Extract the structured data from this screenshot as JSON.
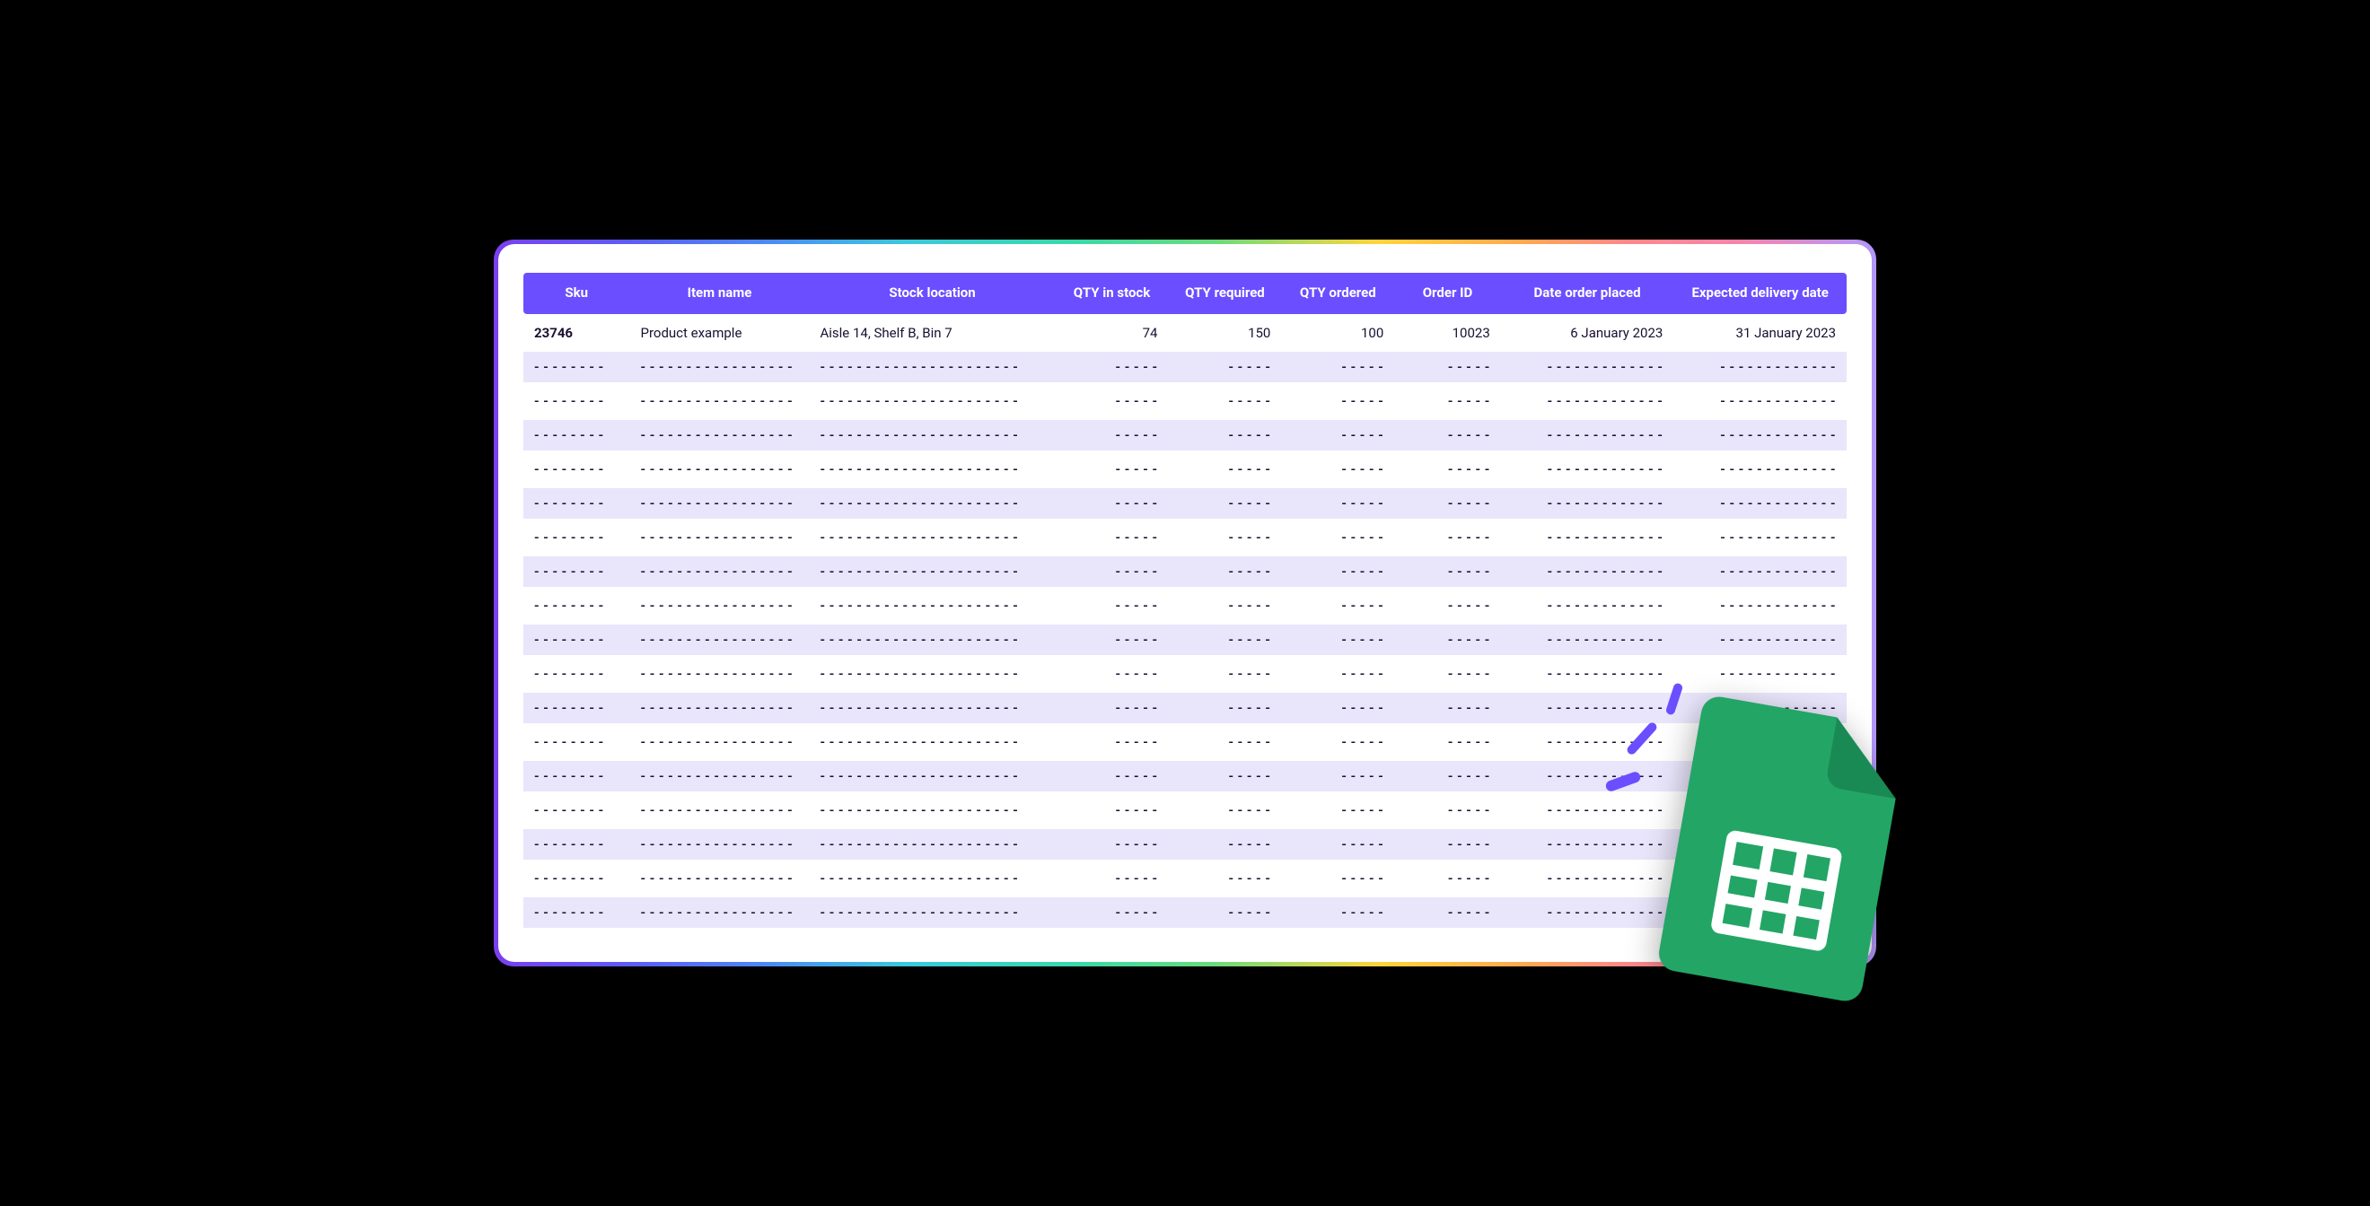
{
  "colors": {
    "header_bg": "#6b4eff",
    "header_text": "#ffffff",
    "placeholder_text": "#a79ef0",
    "row_alt_bg": "#e9e5fb",
    "sheets_green": "#23a566",
    "sheets_dark": "#1e8e5a"
  },
  "table": {
    "headers": {
      "sku": "Sku",
      "item_name": "Item name",
      "stock_location": "Stock location",
      "qty_in_stock": "QTY in stock",
      "qty_required": "QTY required",
      "qty_ordered": "QTY ordered",
      "order_id": "Order ID",
      "date_order_placed": "Date order placed",
      "expected_delivery_date": "Expected delivery date"
    },
    "rows": [
      {
        "sku": "23746",
        "item_name": "Product example",
        "stock_location": "Aisle 14, Shelf B, Bin 7",
        "qty_in_stock": "74",
        "qty_required": "150",
        "qty_ordered": "100",
        "order_id": "10023",
        "date_order_placed": "6 January 2023",
        "expected_delivery_date": "31 January 2023"
      }
    ],
    "placeholder_row_count": 17,
    "placeholder_dashes": {
      "short": "- - - - -",
      "medium": "- - - - - - - -",
      "long": "- - - - - - - - - - - - - - - - -",
      "xlong": "- - - - - - - - - - - - - - - - - - - - - -",
      "date": "- - - - - - - - - - - - -"
    }
  },
  "overlay": {
    "icon_name": "google-sheets-icon",
    "spark_count": 3
  }
}
